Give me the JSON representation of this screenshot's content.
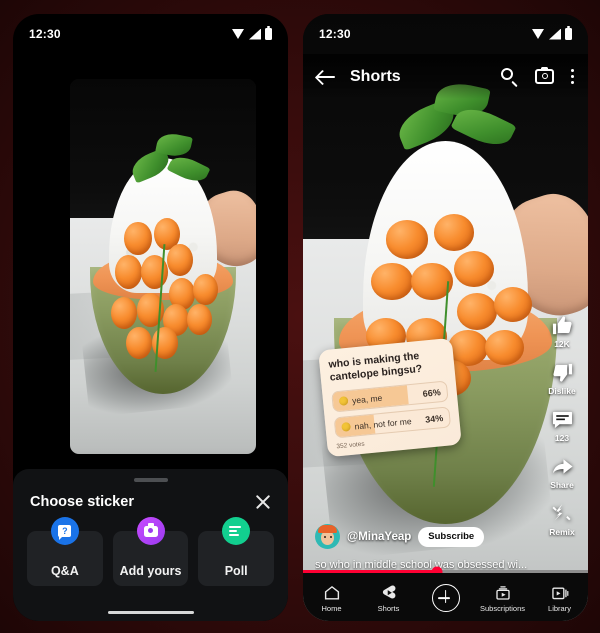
{
  "background_color": "#330b0b",
  "left_phone": {
    "status_bar": {
      "time": "12:30",
      "icons": [
        "wifi-icon",
        "signal-icon",
        "battery-icon"
      ]
    },
    "video": {
      "description": "cantaloupe bingsu dessert video preview"
    },
    "sheet": {
      "title": "Choose sticker",
      "close_label": "close-icon",
      "stickers": [
        {
          "label": "Q&A",
          "icon": "question-bubble-icon",
          "color": "#1a73e8"
        },
        {
          "label": "Add yours",
          "icon": "camera-icon",
          "color": "#9b3bf0"
        },
        {
          "label": "Poll",
          "icon": "poll-bars-icon",
          "color": "#12cf8f"
        }
      ]
    }
  },
  "right_phone": {
    "status_bar": {
      "time": "12:30",
      "icons": [
        "wifi-icon",
        "signal-icon",
        "battery-icon"
      ]
    },
    "topbar": {
      "back": "back-arrow-icon",
      "title": "Shorts",
      "search": "search-icon",
      "camera": "camera-icon",
      "more": "more-vertical-icon"
    },
    "poll_sticker": {
      "question": "who is making the cantelope bingsu?",
      "options": [
        {
          "label": "yea, me",
          "percent": "66%",
          "fill": 66,
          "emoji": "smiley-emoji"
        },
        {
          "label": "nah, not for me",
          "percent": "34%",
          "fill": 34,
          "emoji": "smiley-emoji"
        }
      ],
      "votes": "352 votes"
    },
    "actions": [
      {
        "icon": "thumbs-up-icon",
        "label": "12K"
      },
      {
        "icon": "thumbs-down-icon",
        "label": "Dislike"
      },
      {
        "icon": "comment-icon",
        "label": "123"
      },
      {
        "icon": "share-icon",
        "label": "Share"
      },
      {
        "icon": "remix-icon",
        "label": "Remix"
      }
    ],
    "channel": {
      "avatar": "channel-avatar",
      "name": "@MinaYeap",
      "subscribe_label": "Subscribe"
    },
    "caption": "so who in middle school was obsessed wi...",
    "progress": {
      "percent": 47,
      "played_color": "#ff0033",
      "track_color": "#8e8e8e"
    },
    "bottom_nav": [
      {
        "label": "Home",
        "icon": "home-icon"
      },
      {
        "label": "Shorts",
        "icon": "shorts-icon"
      },
      {
        "label": "",
        "icon": "create-plus-icon"
      },
      {
        "label": "Subscriptions",
        "icon": "subscriptions-icon"
      },
      {
        "label": "Library",
        "icon": "library-icon"
      }
    ]
  }
}
